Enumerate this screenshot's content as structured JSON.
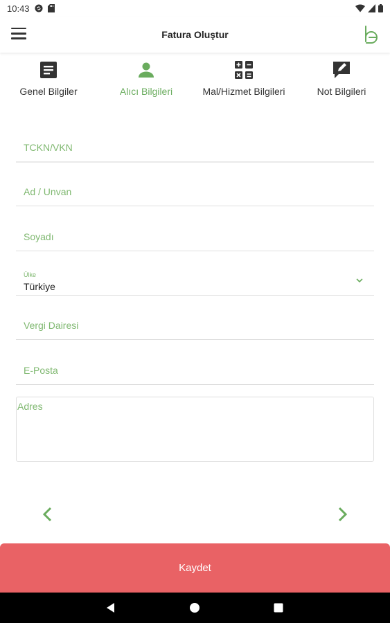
{
  "status_bar": {
    "time": "10:43"
  },
  "app_bar": {
    "title": "Fatura Oluştur"
  },
  "tabs": [
    {
      "label": "Genel Bilgiler",
      "icon": "document-icon",
      "active": false
    },
    {
      "label": "Alıcı Bilgileri",
      "icon": "person-icon",
      "active": true
    },
    {
      "label": "Mal/Hizmet Bilgileri",
      "icon": "calculator-icon",
      "active": false
    },
    {
      "label": "Not Bilgileri",
      "icon": "note-edit-icon",
      "active": false
    }
  ],
  "form": {
    "tckn_placeholder": "TCKN/VKN",
    "name_placeholder": "Ad / Unvan",
    "surname_placeholder": "Soyadı",
    "country_label": "Ülke",
    "country_value": "Türkiye",
    "tax_office_placeholder": "Vergi Dairesi",
    "email_placeholder": "E-Posta",
    "address_placeholder": "Adres"
  },
  "actions": {
    "save_label": "Kaydet"
  },
  "colors": {
    "accent_green": "#6aac5e",
    "save_red": "#e96265",
    "text_dark": "#333333"
  }
}
